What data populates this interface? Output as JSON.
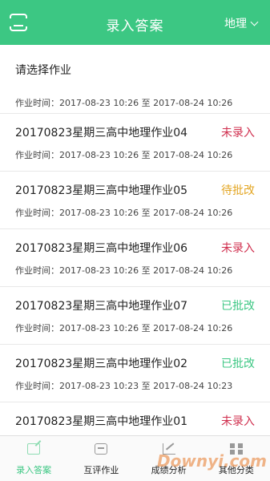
{
  "header": {
    "title": "录入答案",
    "subject": "地理",
    "accent_color": "#3cc783"
  },
  "prompt": {
    "label": "请选择作业",
    "time": "作业时间：2017-08-23 10:26 至 2017-08-24 10:26"
  },
  "homework_list": [
    {
      "title": "20170823星期三高中地理作业04",
      "status": "未录入",
      "status_color": "#d0304f",
      "time": "作业时间：2017-08-23 10:26 至 2017-08-24 10:26"
    },
    {
      "title": "20170823星期三高中地理作业05",
      "status": "待批改",
      "status_color": "#e3a521",
      "time": "作业时间：2017-08-23 10:26 至 2017-08-24 10:26"
    },
    {
      "title": "20170823星期三高中地理作业06",
      "status": "未录入",
      "status_color": "#d0304f",
      "time": "作业时间：2017-08-23 10:26 至 2017-08-24 10:26"
    },
    {
      "title": "20170823星期三高中地理作业07",
      "status": "已批改",
      "status_color": "#3cc783",
      "time": "作业时间：2017-08-23 10:26 至 2017-08-24 10:26"
    },
    {
      "title": "20170823星期三高中地理作业02",
      "status": "已批改",
      "status_color": "#3cc783",
      "time": "作业时间：2017-08-23 10:23 至 2017-08-24 10:23"
    },
    {
      "title": "20170823星期三高中地理作业01",
      "status": "未录入",
      "status_color": "#d0304f",
      "time": ""
    }
  ],
  "tabbar": {
    "tabs": [
      {
        "label": "录入答案",
        "icon": "edit-icon"
      },
      {
        "label": "互评作业",
        "icon": "chat-icon"
      },
      {
        "label": "成绩分析",
        "icon": "chart-icon"
      },
      {
        "label": "其他分类",
        "icon": "grid-icon"
      }
    ],
    "active_index": 0
  },
  "watermark": "Downyi.com"
}
